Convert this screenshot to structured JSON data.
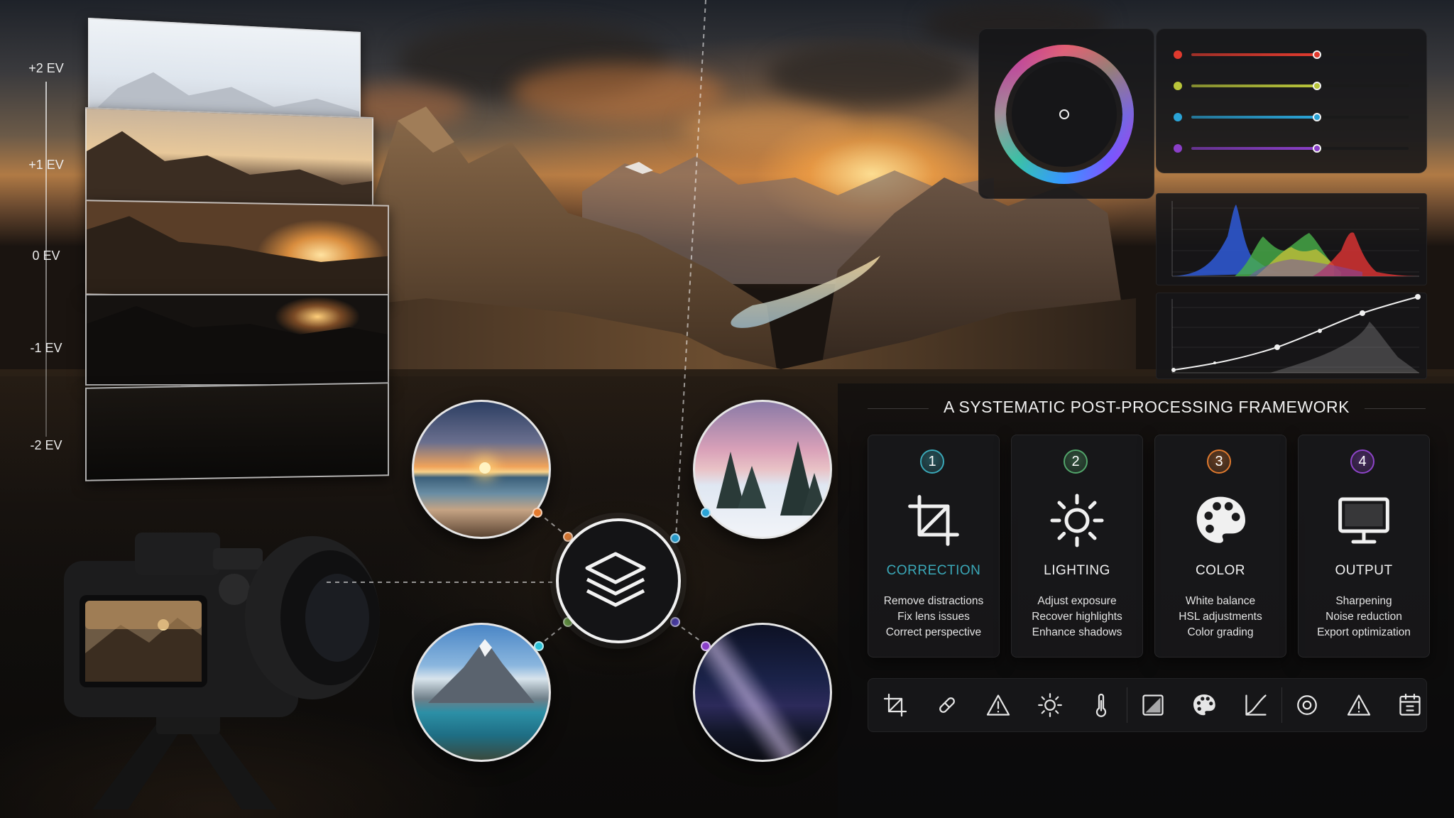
{
  "ev_labels": [
    "+2 EV",
    "+1 EV",
    "0 EV",
    "-1 EV",
    "-2 EV"
  ],
  "framework": {
    "title": "A SYSTEMATIC POST-PROCESSING FRAMEWORK",
    "steps": [
      {
        "num": "1",
        "title": "CORRECTION",
        "icon": "crop-icon",
        "color": "#3aa8b8",
        "lines": [
          "Remove distractions",
          "Fix lens issues",
          "Correct perspective"
        ]
      },
      {
        "num": "2",
        "title": "LIGHTING",
        "icon": "sun-icon",
        "color": "#52a56a",
        "lines": [
          "Adjust exposure",
          "Recover highlights",
          "Enhance shadows"
        ]
      },
      {
        "num": "3",
        "title": "COLOR",
        "icon": "palette-icon",
        "color": "#e07a2e",
        "lines": [
          "White balance",
          "HSL adjustments",
          "Color grading"
        ]
      },
      {
        "num": "4",
        "title": "OUTPUT",
        "icon": "monitor-icon",
        "color": "#8e44c9",
        "lines": [
          "Sharpening",
          "Noise reduction",
          "Export optimization"
        ]
      }
    ]
  },
  "sliders": [
    {
      "color": "#e03a2e",
      "level": 0.58
    },
    {
      "color": "#b9c53a",
      "level": 0.58
    },
    {
      "color": "#2aa3d6",
      "level": 0.58
    },
    {
      "color": "#8a3fc8",
      "level": 0.58
    }
  ],
  "toolbar_icons": [
    "crop-icon",
    "healing-brush-icon",
    "warning-triangle-icon",
    "sun-icon",
    "thermometer-icon",
    "gradient-square-icon",
    "palette-icon",
    "curve-icon",
    "target-icon",
    "warning-triangle-icon",
    "calendar-grid-icon"
  ],
  "hub_icon": "layers-icon",
  "thumbnails": [
    "beach-sunset",
    "snowy-forest",
    "mountain-lake",
    "milky-way-night"
  ]
}
